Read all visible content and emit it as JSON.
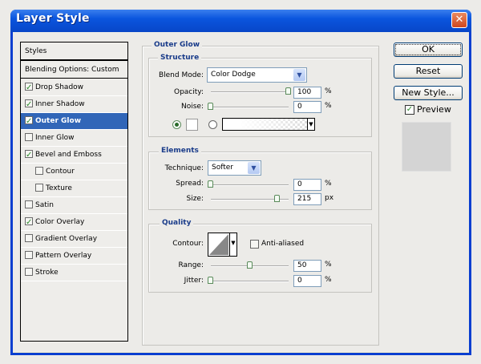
{
  "window": {
    "title": "Layer Style",
    "close_label": "✕"
  },
  "sidebar": {
    "header": "Styles",
    "blending": "Blending Options: Custom",
    "items": [
      {
        "label": "Drop Shadow",
        "checked": true,
        "indent": false
      },
      {
        "label": "Inner Shadow",
        "checked": true,
        "indent": false
      },
      {
        "label": "Outer Glow",
        "checked": true,
        "indent": false,
        "selected": true
      },
      {
        "label": "Inner Glow",
        "checked": false,
        "indent": false
      },
      {
        "label": "Bevel and Emboss",
        "checked": true,
        "indent": false
      },
      {
        "label": "Contour",
        "checked": false,
        "indent": true
      },
      {
        "label": "Texture",
        "checked": false,
        "indent": true
      },
      {
        "label": "Satin",
        "checked": false,
        "indent": false
      },
      {
        "label": "Color Overlay",
        "checked": true,
        "indent": false
      },
      {
        "label": "Gradient Overlay",
        "checked": false,
        "indent": false
      },
      {
        "label": "Pattern Overlay",
        "checked": false,
        "indent": false
      },
      {
        "label": "Stroke",
        "checked": false,
        "indent": false
      }
    ]
  },
  "panel": {
    "title": "Outer Glow",
    "structure": {
      "title": "Structure",
      "blend_mode_label": "Blend Mode:",
      "blend_mode": "Color Dodge",
      "opacity_label": "Opacity:",
      "opacity": "100",
      "opacity_unit": "%",
      "opacity_pct": 100,
      "noise_label": "Noise:",
      "noise": "0",
      "noise_unit": "%",
      "noise_pct": 0
    },
    "elements": {
      "title": "Elements",
      "technique_label": "Technique:",
      "technique": "Softer",
      "spread_label": "Spread:",
      "spread": "0",
      "spread_unit": "%",
      "spread_pct": 0,
      "size_label": "Size:",
      "size": "215",
      "size_unit": "px",
      "size_pct": 86
    },
    "quality": {
      "title": "Quality",
      "contour_label": "Contour:",
      "anti_aliased_label": "Anti-aliased",
      "anti_aliased": false,
      "range_label": "Range:",
      "range": "50",
      "range_unit": "%",
      "range_pct": 50,
      "jitter_label": "Jitter:",
      "jitter": "0",
      "jitter_unit": "%",
      "jitter_pct": 0
    }
  },
  "buttons": {
    "ok": "OK",
    "reset": "Reset",
    "new_style": "New Style...",
    "preview_label": "Preview",
    "preview_checked": true
  },
  "colors": {
    "accent": "#3166b8",
    "title_blue": "#0a55de",
    "group_title": "#1a3c8a"
  }
}
